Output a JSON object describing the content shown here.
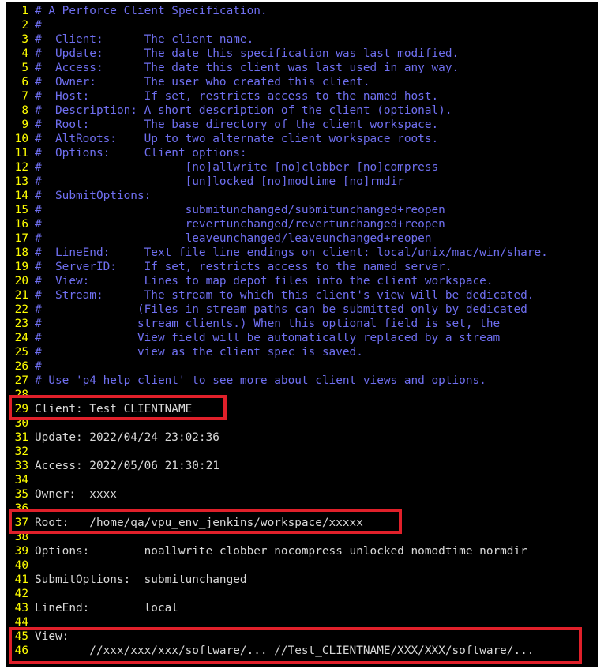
{
  "editor": {
    "lines": [
      {
        "n": "1",
        "text": "# A Perforce Client Specification.",
        "kind": "comment"
      },
      {
        "n": "2",
        "text": "#",
        "kind": "comment"
      },
      {
        "n": "3",
        "text": "#  Client:      The client name.",
        "kind": "comment"
      },
      {
        "n": "4",
        "text": "#  Update:      The date this specification was last modified.",
        "kind": "comment"
      },
      {
        "n": "5",
        "text": "#  Access:      The date this client was last used in any way.",
        "kind": "comment"
      },
      {
        "n": "6",
        "text": "#  Owner:       The user who created this client.",
        "kind": "comment"
      },
      {
        "n": "7",
        "text": "#  Host:        If set, restricts access to the named host.",
        "kind": "comment"
      },
      {
        "n": "8",
        "text": "#  Description: A short description of the client (optional).",
        "kind": "comment"
      },
      {
        "n": "9",
        "text": "#  Root:        The base directory of the client workspace.",
        "kind": "comment"
      },
      {
        "n": "10",
        "text": "#  AltRoots:    Up to two alternate client workspace roots.",
        "kind": "comment"
      },
      {
        "n": "11",
        "text": "#  Options:     Client options:",
        "kind": "comment"
      },
      {
        "n": "12",
        "text": "#                     [no]allwrite [no]clobber [no]compress",
        "kind": "comment"
      },
      {
        "n": "13",
        "text": "#                     [un]locked [no]modtime [no]rmdir",
        "kind": "comment"
      },
      {
        "n": "14",
        "text": "#  SubmitOptions:",
        "kind": "comment"
      },
      {
        "n": "15",
        "text": "#                     submitunchanged/submitunchanged+reopen",
        "kind": "comment"
      },
      {
        "n": "16",
        "text": "#                     revertunchanged/revertunchanged+reopen",
        "kind": "comment"
      },
      {
        "n": "17",
        "text": "#                     leaveunchanged/leaveunchanged+reopen",
        "kind": "comment"
      },
      {
        "n": "18",
        "text": "#  LineEnd:     Text file line endings on client: local/unix/mac/win/share.",
        "kind": "comment"
      },
      {
        "n": "19",
        "text": "#  ServerID:    If set, restricts access to the named server.",
        "kind": "comment"
      },
      {
        "n": "20",
        "text": "#  View:        Lines to map depot files into the client workspace.",
        "kind": "comment"
      },
      {
        "n": "21",
        "text": "#  Stream:      The stream to which this client's view will be dedicated.",
        "kind": "comment"
      },
      {
        "n": "22",
        "text": "#              (Files in stream paths can be submitted only by dedicated",
        "kind": "comment"
      },
      {
        "n": "23",
        "text": "#              stream clients.) When this optional field is set, the",
        "kind": "comment"
      },
      {
        "n": "24",
        "text": "#              View field will be automatically replaced by a stream",
        "kind": "comment"
      },
      {
        "n": "25",
        "text": "#              view as the client spec is saved.",
        "kind": "comment"
      },
      {
        "n": "26",
        "text": "#",
        "kind": "comment"
      },
      {
        "n": "27",
        "text": "# Use 'p4 help client' to see more about client views and options.",
        "kind": "comment"
      },
      {
        "n": "28",
        "text": "",
        "kind": "plain"
      },
      {
        "n": "29",
        "text": "Client: Test_CLIENTNAME",
        "kind": "plain"
      },
      {
        "n": "30",
        "text": "",
        "kind": "plain"
      },
      {
        "n": "31",
        "text": "Update: 2022/04/24 23:02:36",
        "kind": "plain"
      },
      {
        "n": "32",
        "text": "",
        "kind": "plain"
      },
      {
        "n": "33",
        "text": "Access: 2022/05/06 21:30:21",
        "kind": "plain"
      },
      {
        "n": "34",
        "text": "",
        "kind": "plain"
      },
      {
        "n": "35",
        "text": "Owner:  xxxx",
        "kind": "plain"
      },
      {
        "n": "36",
        "text": "",
        "kind": "plain"
      },
      {
        "n": "37",
        "text": "Root:   /home/qa/vpu_env_jenkins/workspace/xxxxx",
        "kind": "plain"
      },
      {
        "n": "38",
        "text": "",
        "kind": "plain"
      },
      {
        "n": "39",
        "text": "Options:        noallwrite clobber nocompress unlocked nomodtime normdir",
        "kind": "plain"
      },
      {
        "n": "40",
        "text": "",
        "kind": "plain"
      },
      {
        "n": "41",
        "text": "SubmitOptions:  submitunchanged",
        "kind": "plain"
      },
      {
        "n": "42",
        "text": "",
        "kind": "plain"
      },
      {
        "n": "43",
        "text": "LineEnd:        local",
        "kind": "plain"
      },
      {
        "n": "44",
        "text": "",
        "kind": "plain"
      },
      {
        "n": "45",
        "text": "View:",
        "kind": "plain"
      },
      {
        "n": "46",
        "text": "        //xxx/xxx/xxx/software/... //Test_CLIENTNAME/XXX/XXX/software/...",
        "kind": "plain"
      }
    ]
  },
  "colors": {
    "background": "#000000",
    "line_number": "#ffff00",
    "comment": "#6f6ff0",
    "text": "#d8d8d8",
    "highlight_box": "#e0202a"
  }
}
